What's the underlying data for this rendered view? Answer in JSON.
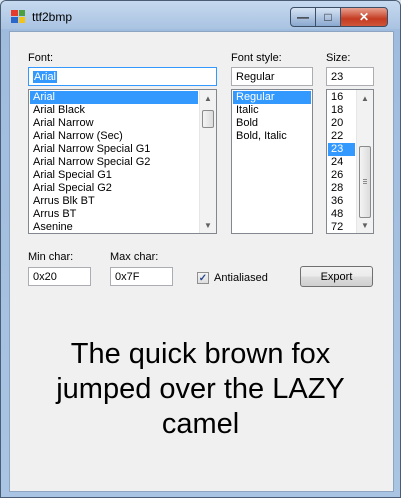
{
  "window": {
    "title": "ttf2bmp"
  },
  "font": {
    "label": "Font:",
    "value": "Arial",
    "items": [
      "Arial",
      "Arial Black",
      "Arial Narrow",
      "Arial Narrow (Sec)",
      "Arial Narrow Special G1",
      "Arial Narrow Special G2",
      "Arial Special G1",
      "Arial Special G2",
      "Arrus Blk BT",
      "Arrus BT",
      "Asenine"
    ],
    "selected_index": 0
  },
  "font_style": {
    "label": "Font style:",
    "value": "Regular",
    "items": [
      "Regular",
      "Italic",
      "Bold",
      "Bold, Italic"
    ],
    "selected_index": 0
  },
  "size": {
    "label": "Size:",
    "value": "23",
    "items": [
      "16",
      "18",
      "20",
      "22",
      "23",
      "24",
      "26",
      "28",
      "36",
      "48",
      "72"
    ],
    "selected_index": 4
  },
  "min_char": {
    "label": "Min char:",
    "value": "0x20"
  },
  "max_char": {
    "label": "Max char:",
    "value": "0x7F"
  },
  "antialiased": {
    "label": "Antialiased",
    "checked": true
  },
  "export_label": "Export",
  "preview_lines": [
    "The quick brown fox",
    "jumped over the LAZY",
    "camel"
  ]
}
